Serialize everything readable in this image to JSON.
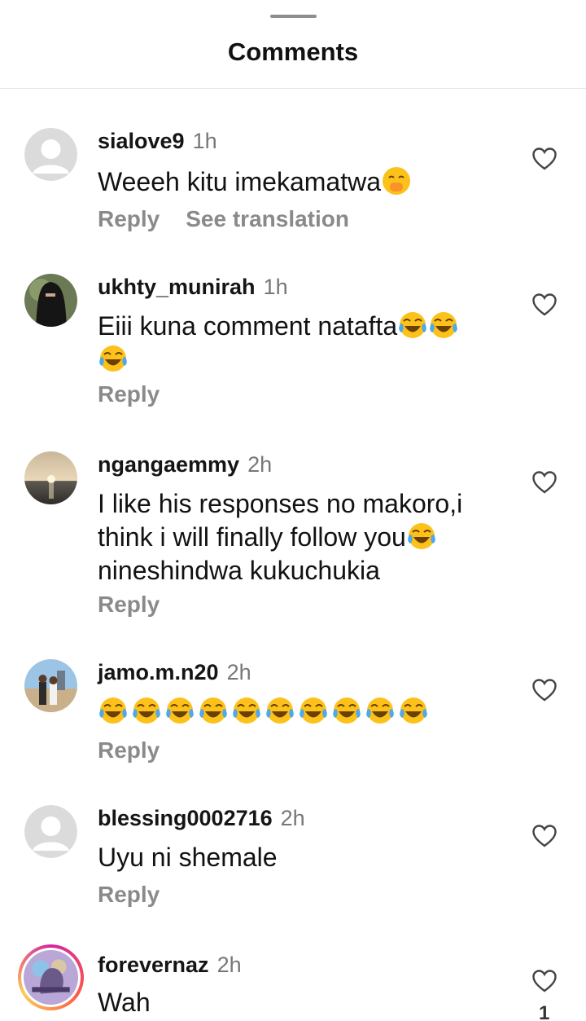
{
  "sheet": {
    "title": "Comments"
  },
  "comments": [
    {
      "username": "sialove9",
      "time": "1h",
      "text": "Weeeh kitu imekamatwa",
      "emoji": "hand-over-mouth",
      "emoji_count": 1,
      "actions": [
        "Reply",
        "See translation"
      ],
      "avatar": "default"
    },
    {
      "username": "ukhty_munirah",
      "time": "1h",
      "text": "Eiii kuna comment natafta",
      "emoji": "tears-of-joy",
      "emoji_count": 3,
      "actions": [
        "Reply"
      ],
      "avatar": "veil"
    },
    {
      "username": "ngangaemmy",
      "time": "2h",
      "text": "I like his responses no makoro,i think i will finally follow you",
      "text_after_emoji": "nineshindwa kukuchukia",
      "emoji": "tears-of-joy",
      "emoji_count": 1,
      "actions": [
        "Reply"
      ],
      "avatar": "sunset"
    },
    {
      "username": "jamo.m.n20",
      "time": "2h",
      "text": "",
      "emoji": "tears-of-joy",
      "emoji_count": 10,
      "actions": [
        "Reply"
      ],
      "avatar": "people"
    },
    {
      "username": "blessing0002716",
      "time": "2h",
      "text": "Uyu ni shemale",
      "actions": [
        "Reply"
      ],
      "avatar": "default"
    },
    {
      "username": "forevernaz",
      "time": "2h",
      "text": "Wah",
      "like_count": "1",
      "avatar": "story"
    }
  ],
  "colors": {
    "username": "#151515",
    "meta": "#777777",
    "action": "#8a8a8a"
  }
}
